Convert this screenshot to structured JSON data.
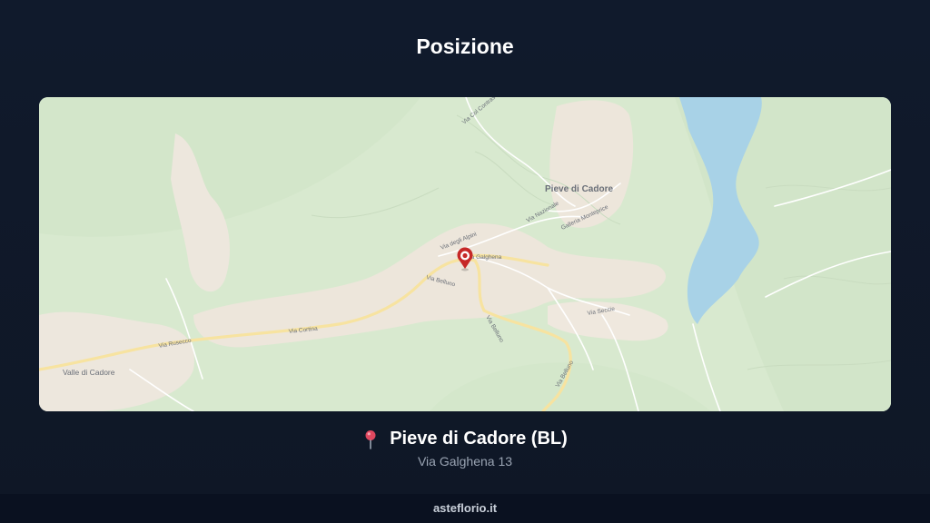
{
  "header": {
    "title": "Posizione"
  },
  "map": {
    "marker_icon": "map-marker-icon",
    "labels": {
      "main_town": "Pieve di Cadore",
      "valle": "Valle di Cadore",
      "via_alpini": "Via degli Alpini",
      "via_galghena": "Via Galghena",
      "via_belluno_1": "Via Belluno",
      "via_belluno_2": "Via Belluno",
      "via_belluno_3": "Via Belluno",
      "via_cortina": "Via Cortina",
      "via_rusecco": "Via Rusecco",
      "via_nazionale": "Via Nazionale",
      "galleria": "Galleria Monteprice",
      "via_col": "Via Col Contras",
      "via_secca": "Via Seccie"
    },
    "colors": {
      "land": "#d7e8cf",
      "urban": "#eee6dc",
      "water": "#a9d3e8",
      "road": "#f6e3a1",
      "marker": "#c62828"
    }
  },
  "location": {
    "pin_icon": "pushpin-icon",
    "name": "Pieve di Cadore (BL)",
    "address": "Via Galghena 13"
  },
  "footer": {
    "site": "asteflorio.it"
  }
}
